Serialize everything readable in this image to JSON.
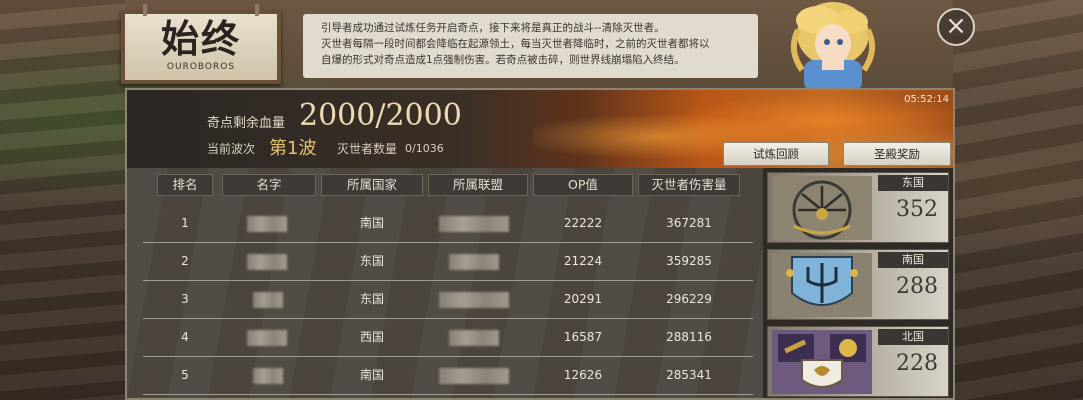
{
  "title": {
    "main": "始终",
    "sub": "OUROBOROS"
  },
  "intro": {
    "lines": [
      "引导者成功通过试炼任务开启奇点，接下来将是真正的战斗--清除灭世者。",
      "灭世者每隔一段时间都会降临在起源领土，每当灭世者降临时，之前的灭世者都将以",
      "自爆的形式对奇点造成1点强制伤害。若奇点被击碎，则世界线崩塌陷入终结。"
    ]
  },
  "close_symbol": "×",
  "status": {
    "timer": "05:52:14",
    "hp_label": "奇点剩余血量",
    "hp_value": "2000/2000",
    "wave_label": "当前波次",
    "wave_value": "第1波",
    "slayer_label": "灭世者数量",
    "slayer_value": "0/1036"
  },
  "buttons": {
    "review": "试炼回顾",
    "reward": "圣殿奖励"
  },
  "table": {
    "headers": [
      "排名",
      "名字",
      "所属国家",
      "所属联盟",
      "OP值",
      "灭世者伤害量"
    ],
    "rows": [
      {
        "rank": "1",
        "country": "南国",
        "op": "22222",
        "damage": "367281"
      },
      {
        "rank": "2",
        "country": "东国",
        "op": "21224",
        "damage": "359285"
      },
      {
        "rank": "3",
        "country": "东国",
        "op": "20291",
        "damage": "296229"
      },
      {
        "rank": "4",
        "country": "西国",
        "op": "16587",
        "damage": "288116"
      },
      {
        "rank": "5",
        "country": "南国",
        "op": "12626",
        "damage": "285341"
      }
    ]
  },
  "factions": [
    {
      "name": "东国",
      "count": "352",
      "icon": "chrysanthemum-emblem-icon"
    },
    {
      "name": "南国",
      "count": "288",
      "icon": "trident-emblem-icon"
    },
    {
      "name": "北国",
      "count": "228",
      "icon": "sun-shield-emblem-icon"
    }
  ],
  "colors": {
    "accent_gold": "#e6c270",
    "flame": "#c26a22",
    "panel": "#3a352f"
  }
}
